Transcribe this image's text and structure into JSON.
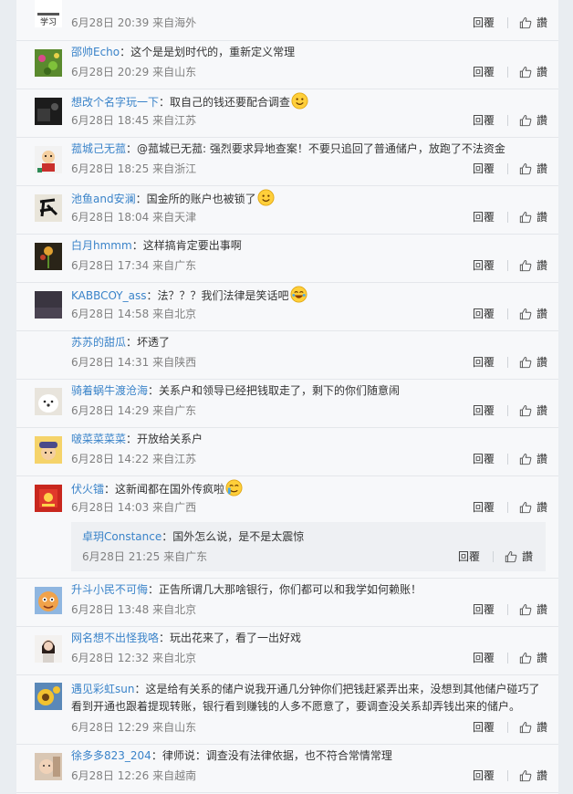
{
  "comments": [
    {
      "user": "",
      "colon": "",
      "text": "",
      "time": "6月28日 20:39 来自海外",
      "reply_label": "回覆",
      "like_label": "讚",
      "avatar": "xuexi-logo"
    },
    {
      "user": "邵帅Echo",
      "colon": "：",
      "text": "这个是是划时代的，重新定义常理",
      "time": "6月28日 20:29 来自山东",
      "reply_label": "回覆",
      "like_label": "讚",
      "avatar": "green-field"
    },
    {
      "user": "想改个名字玩一下",
      "colon": "：",
      "text": "取自己的钱还要配合调查",
      "emoji": "smile-emoji",
      "time": "6月28日 18:45 来自江苏",
      "reply_label": "回覆",
      "like_label": "讚",
      "avatar": "dark-scene"
    },
    {
      "user": "菰城己无菰",
      "colon": "：",
      "text": "@菰城已无菰: 强烈要求异地查案！不要只追回了普通储户，放跑了不法资金",
      "time": "6月28日 18:25 来自浙江",
      "reply_label": "回覆",
      "like_label": "讚",
      "avatar": "cartoon-kid"
    },
    {
      "user": "池鱼and安澜",
      "colon": "：",
      "text": "国金所的账户也被锁了",
      "emoji": "smile-emoji",
      "time": "6月28日 18:04 来自天津",
      "reply_label": "回覆",
      "like_label": "讚",
      "avatar": "calligraphy"
    },
    {
      "user": "白月hmmm",
      "colon": "：",
      "text": "这样搞肯定要出事啊",
      "time": "6月28日 17:34 来自广东",
      "reply_label": "回覆",
      "like_label": "讚",
      "avatar": "flower-plant"
    },
    {
      "user": "KABBCOY_ass",
      "colon": "：",
      "text": "法？？？我们法律是笑话吧",
      "emoji": "laugh-cry-emoji",
      "time": "6月28日 14:58 来自北京",
      "reply_label": "回覆",
      "like_label": "讚",
      "avatar": "dark-purple"
    },
    {
      "user": "苏苏的甜瓜",
      "colon": "：",
      "text": "坏透了",
      "time": "6月28日 14:31 来自陕西",
      "reply_label": "回覆",
      "like_label": "讚",
      "avatar": "none"
    },
    {
      "user": "骑着蜗牛渡沧海",
      "colon": "：",
      "text": "关系户和领导已经把钱取走了，剩下的你们随意闹",
      "time": "6月28日 14:29 来自广东",
      "reply_label": "回覆",
      "like_label": "讚",
      "avatar": "white-dog"
    },
    {
      "user": "啵菜菜菜菜",
      "colon": "：",
      "text": "开放给关系户",
      "time": "6月28日 14:22 来自江苏",
      "reply_label": "回覆",
      "like_label": "讚",
      "avatar": "cartoon-hat"
    },
    {
      "user": "伏火镭",
      "colon": "：",
      "text": "这新闻都在国外传疯啦",
      "emoji": "cry-emoji",
      "time": "6月28日 14:03 来自广西",
      "reply_label": "回覆",
      "like_label": "讚",
      "avatar": "red-poster"
    },
    {
      "user": "升斗小民不可侮",
      "colon": "：",
      "text": "正告所谓几大那啥银行，你们都可以和我学如何赖账！",
      "time": "6月28日 13:48 来自北京",
      "reply_label": "回覆",
      "like_label": "讚",
      "avatar": "cartoon-boy"
    },
    {
      "user": "网名想不出怪我咯",
      "colon": "：",
      "text": "玩出花来了，看了一出好戏",
      "time": "6月28日 12:32 来自北京",
      "reply_label": "回覆",
      "like_label": "讚",
      "avatar": "girl-photo"
    },
    {
      "user": "遇见彩虹sun",
      "colon": "：",
      "text": "这是给有关系的储户说我开通几分钟你们把钱赶紧弄出来，没想到其他储户碰巧了看到开通也跟着提现转账，银行看到赚钱的人多不愿意了，要调查没关系却弄钱出来的储户。",
      "time": "6月28日 12:29 来自山东",
      "reply_label": "回覆",
      "like_label": "讚",
      "avatar": "sunflower"
    },
    {
      "user": "徐多多823_204",
      "colon": "：",
      "text": "律师说：调查没有法律依据，也不符合常情常理",
      "time": "6月28日 12:26 来自越南",
      "reply_label": "回覆",
      "like_label": "讚",
      "avatar": "baby-photo"
    }
  ],
  "sub_reply": {
    "user": "卓玥Constance",
    "colon": "：",
    "text": "国外怎么说，是不是太震惊",
    "time": "6月28日 21:25 来自广东",
    "reply_label": "回覆",
    "like_label": "讚"
  },
  "colors": {
    "username": "#3a83c9",
    "meta": "#808080",
    "background": "#f7f8fa",
    "sub_background": "#eef0f3"
  }
}
